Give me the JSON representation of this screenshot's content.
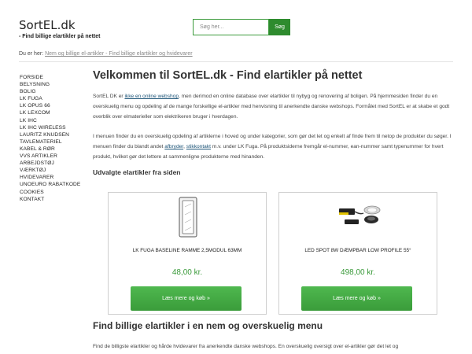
{
  "header": {
    "site_title": "SortEL.dk",
    "tagline": "- Find billige elartikler på nettet",
    "search_placeholder": "Søg her...",
    "search_button": "Søg"
  },
  "breadcrumb": {
    "prefix": "Du er her:",
    "link": "Nem og billige el-artikler - Find billige elartikler og hvidevarer"
  },
  "sidebar": {
    "items": [
      "FORSIDE",
      "BELYSNING",
      "BOLIG",
      "LK FUGA",
      "LK OPUS 66",
      "LK LEXCOM",
      "LK IHC",
      "LK IHC WIRELESS",
      "LAURITZ KNUDSEN",
      "TAVLEMATERIEL",
      "KABEL & RØR",
      "VVS ARTIKLER",
      "ARBEJDSTØJ",
      "VÆRKTØJ",
      "HVIDEVARER",
      "UNOEURO RABATKODE",
      "COOKIES",
      "KONTAKT"
    ]
  },
  "main": {
    "title": "Velkommen til SortEL.dk - Find elartikler på nettet",
    "para1_a": "SortEL DK er ",
    "para1_link": "ikke en online webshop",
    "para1_b": ", men derimod en online database over elartikler til nybyg og renovering af boligen. På hjemmesiden finder du en overskuelig menu og opdeling af de mange forskellige el-artikler med henvisning til anerkendte danske webshops. Formålet med SortEL er at skabe et godt overblik over elmaterieller som elektrikeren bruger i hverdagen.",
    "para2_a": "I menuen finder du en overskuelig opdeling af artiklerne i hoved og under kategorier, som gør det let og enkelt af finde frem til netop de produkter du søger. I menuen finder du blandt andet ",
    "para2_link1": "afbryder",
    "para2_sep": ", ",
    "para2_link2": "stikkontakt",
    "para2_b": " m.v. under LK Fuga. På produktsiderne fremgår el-nummer, ean-nummer samt typenummer for hvert produkt, hvilket gør det lettere at sammenligne produkterne med hinanden.",
    "products_heading": "Udvalgte elartikler fra siden",
    "heading2": "Find billige elartikler i en nem og overskuelig menu",
    "para3": "Find de billigste elartikler og hårde hvidevarer fra anerkendte danske webshops. En overskuelig oversigt over el-artikler gør det let og"
  },
  "products": [
    {
      "name": "LK FUGA BASELINE RAMME 2,5MODUL 63MM",
      "price": "48,00 kr.",
      "button": "Læs mere og køb »",
      "icon": "frame-icon"
    },
    {
      "name": "LED SPOT 8W DÆMPBAR LOW PROFILE 55°",
      "price": "498,00 kr.",
      "button": "Læs mere og køb »",
      "icon": "led-spot-icon"
    }
  ],
  "colors": {
    "accent_green": "#3a9c3a",
    "link": "#1a5276"
  }
}
